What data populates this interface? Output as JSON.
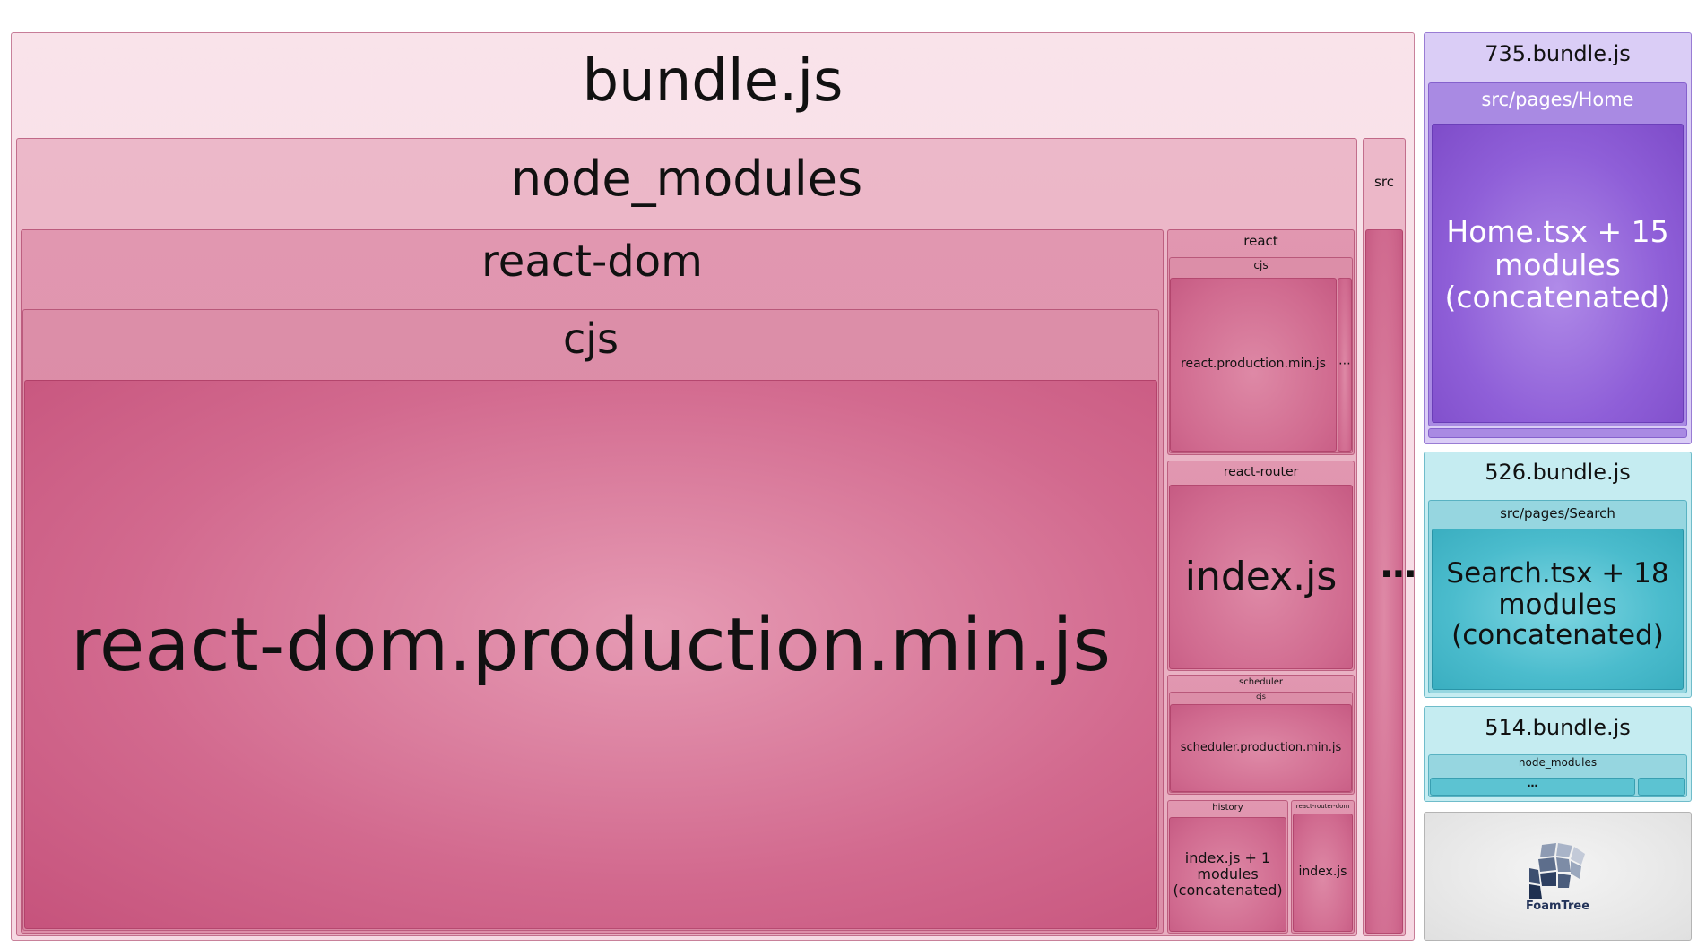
{
  "chunks": {
    "bundle": {
      "name": "bundle.js",
      "node_modules": {
        "name": "node_modules",
        "react_dom": {
          "name": "react-dom",
          "cjs": "cjs",
          "leaf": "react-dom.production.min.js"
        },
        "react": {
          "name": "react",
          "cjs": "cjs",
          "leaf": "react.production.min.js",
          "more": "⋯"
        },
        "react_router": {
          "name": "react-router",
          "leaf": "index.js"
        },
        "scheduler": {
          "name": "scheduler",
          "cjs": "cjs",
          "leaf": "scheduler.production.min.js"
        },
        "history": {
          "name": "history",
          "leaf": "index.js + 1 modules (concatenated)"
        },
        "react_router_dom": {
          "name": "react-router-dom",
          "leaf": "index.js"
        }
      },
      "src": {
        "name": "src"
      },
      "more": "⋯"
    },
    "c735": {
      "name": "735.bundle.js",
      "folder": "src/pages/Home",
      "leaf": "Home.tsx + 15 modules (concatenated)"
    },
    "c526": {
      "name": "526.bundle.js",
      "folder": "src/pages/Search",
      "leaf": "Search.tsx + 18 modules (concatenated)"
    },
    "c514": {
      "name": "514.bundle.js",
      "folder": "node_modules",
      "more": "⋯"
    }
  },
  "logo": {
    "text": "FoamTree",
    "icon": "foamtree-logo-icon"
  },
  "colors": {
    "bundle": "#f7dce5",
    "leaf_pink": "#d2698e",
    "purple": "#8f5fd8",
    "teal": "#4bbccd"
  }
}
